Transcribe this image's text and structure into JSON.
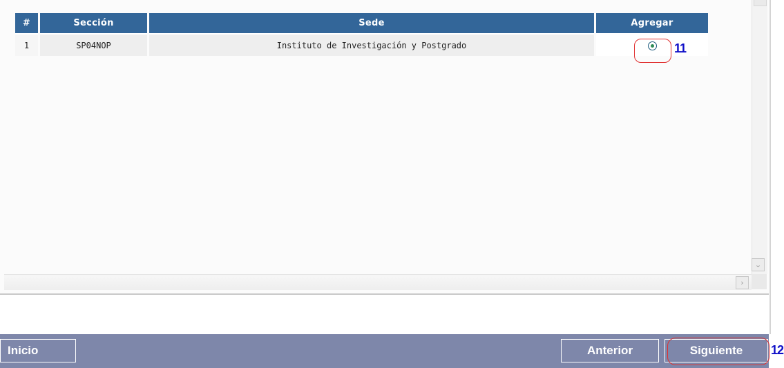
{
  "table": {
    "headers": {
      "num": "#",
      "seccion": "Sección",
      "sede": "Sede",
      "agregar": "Agregar"
    },
    "rows": [
      {
        "num": "1",
        "seccion": "SP04NOP",
        "sede": "Instituto de Investigación y Postgrado",
        "agregar_selected": true
      }
    ]
  },
  "annotations": {
    "step_radio": "11",
    "step_next": "12"
  },
  "nav": {
    "inicio": "Inicio",
    "anterior": "Anterior",
    "siguiente": "Siguiente"
  },
  "colors": {
    "header_bg": "#336699",
    "navbar_bg": "#7e87aa",
    "annotation_oval": "#e03030",
    "annotation_number": "#1010c8"
  },
  "icons": {
    "scroll_down": "chevron-down-icon",
    "scroll_right": "chevron-right-icon",
    "radio": "radio-selected-icon"
  }
}
